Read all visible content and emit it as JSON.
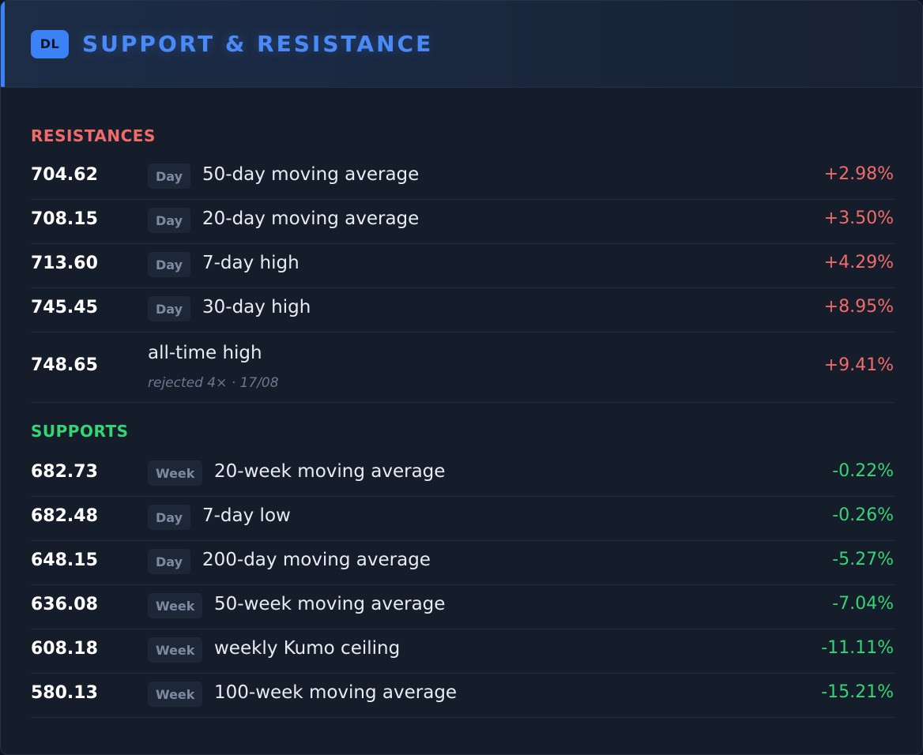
{
  "header": {
    "badge": "DL",
    "title": "SUPPORT & RESISTANCE",
    "accent": "#3b82f6"
  },
  "resistances": {
    "title": "RESISTANCES",
    "color": "#f26b6b",
    "rows": [
      {
        "price": "704.62",
        "timeframe": "Day",
        "label": "50-day moving average",
        "change": "+2.98%"
      },
      {
        "price": "708.15",
        "timeframe": "Day",
        "label": "20-day moving average",
        "change": "+3.50%"
      },
      {
        "price": "713.60",
        "timeframe": "Day",
        "label": "7-day high",
        "change": "+4.29%"
      },
      {
        "price": "745.45",
        "timeframe": "Day",
        "label": "30-day high",
        "change": "+8.95%"
      },
      {
        "price": "748.65",
        "timeframe": "",
        "label": "all-time high",
        "note": "rejected 4× · 17/08",
        "change": "+9.41%"
      }
    ]
  },
  "supports": {
    "title": "SUPPORTS",
    "color": "#36d474",
    "rows": [
      {
        "price": "682.73",
        "timeframe": "Week",
        "label": "20-week moving average",
        "change": "-0.22%"
      },
      {
        "price": "682.48",
        "timeframe": "Day",
        "label": "7-day low",
        "change": "-0.26%"
      },
      {
        "price": "648.15",
        "timeframe": "Day",
        "label": "200-day moving average",
        "change": "-5.27%"
      },
      {
        "price": "636.08",
        "timeframe": "Week",
        "label": "50-week moving average",
        "change": "-7.04%"
      },
      {
        "price": "608.18",
        "timeframe": "Week",
        "label": "weekly Kumo ceiling",
        "change": "-11.11%"
      },
      {
        "price": "580.13",
        "timeframe": "Week",
        "label": "100-week moving average",
        "change": "-15.21%"
      }
    ]
  }
}
